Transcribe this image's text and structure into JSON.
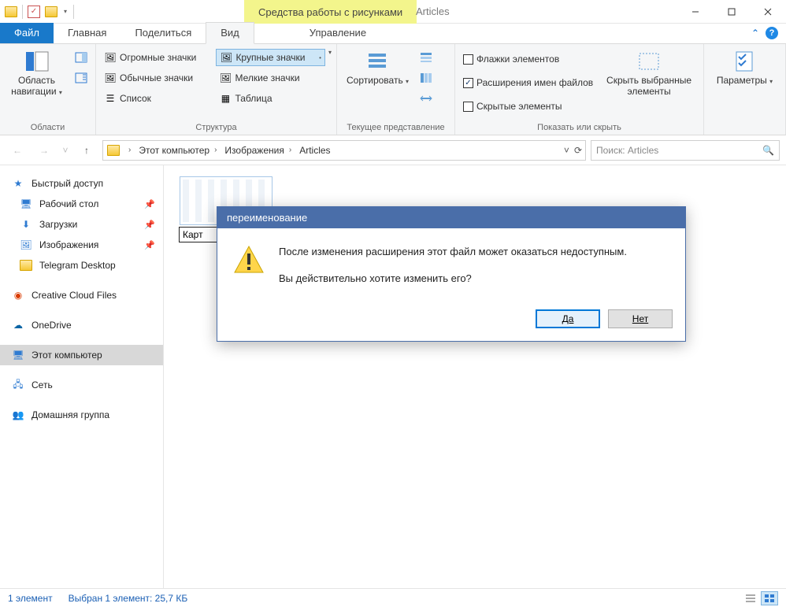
{
  "window": {
    "context_tab": "Средства работы с рисунками",
    "title": "Articles"
  },
  "tabs": {
    "file": "Файл",
    "home": "Главная",
    "share": "Поделиться",
    "view": "Вид",
    "manage": "Управление"
  },
  "ribbon": {
    "groups": {
      "panes": "Области",
      "layout": "Структура",
      "current": "Текущее представление",
      "showhide": "Показать или скрыть"
    },
    "nav_pane": "Область навигации",
    "icon_sizes": {
      "huge": "Огромные значки",
      "large": "Крупные значки",
      "medium": "Обычные значки",
      "small": "Мелкие значки",
      "list": "Список",
      "table": "Таблица"
    },
    "sort": "Сортировать",
    "checks": {
      "item_checkboxes": "Флажки элементов",
      "extensions": "Расширения имен файлов",
      "hidden": "Скрытые элементы"
    },
    "hide_selected": "Скрыть выбранные элементы",
    "options": "Параметры"
  },
  "breadcrumb": {
    "this_pc": "Этот компьютер",
    "pictures": "Изображения",
    "folder": "Articles"
  },
  "search": {
    "placeholder": "Поиск: Articles"
  },
  "sidebar": {
    "quick_access": "Быстрый доступ",
    "desktop": "Рабочий стол",
    "downloads": "Загрузки",
    "pictures": "Изображения",
    "telegram": "Telegram Desktop",
    "creative_cloud": "Creative Cloud Files",
    "onedrive": "OneDrive",
    "this_pc": "Этот компьютер",
    "network": "Сеть",
    "homegroup": "Домашняя группа"
  },
  "file": {
    "rename_visible": "Карт"
  },
  "dialog": {
    "title": "переименование",
    "line1": "После изменения расширения этот файл может оказаться недоступным.",
    "line2": "Вы действительно хотите изменить его?",
    "yes": "Да",
    "no": "Нет"
  },
  "status": {
    "count": "1 элемент",
    "selection": "Выбран 1 элемент: 25,7 КБ"
  }
}
